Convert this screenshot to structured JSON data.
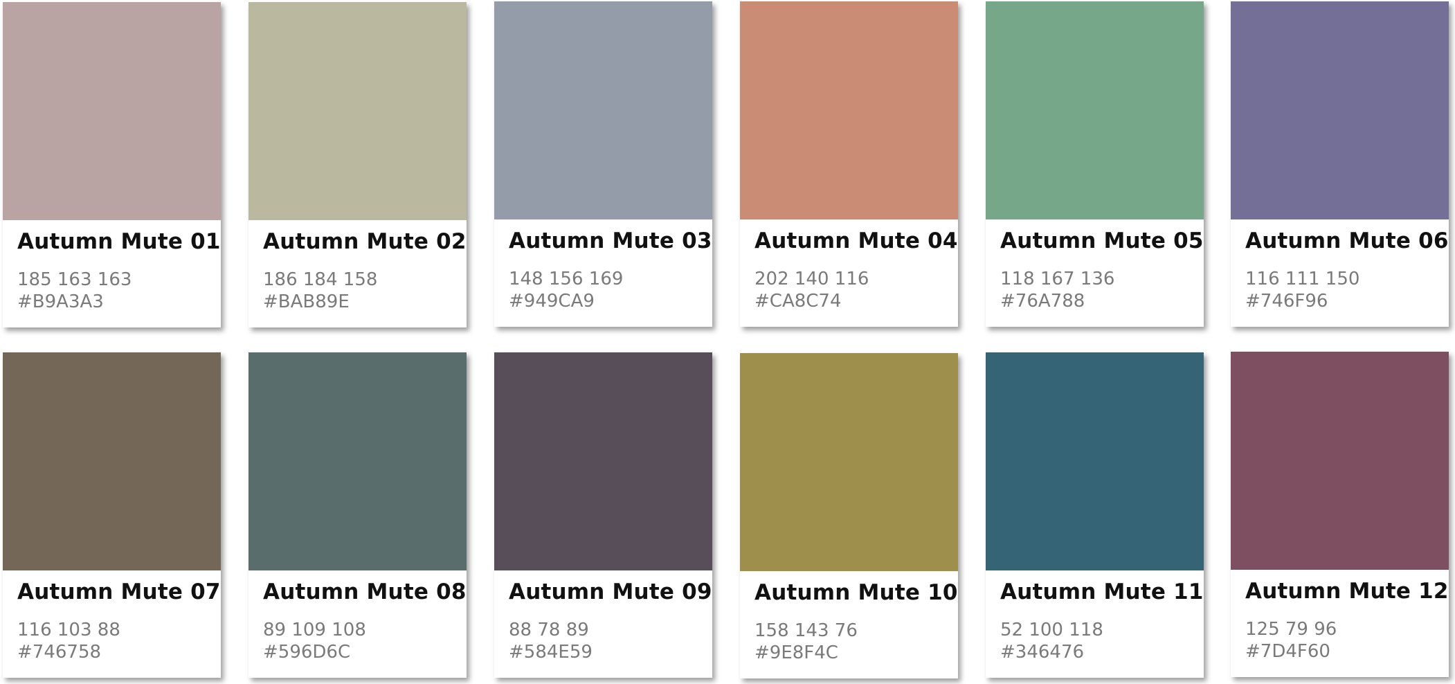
{
  "palette": {
    "swatches": [
      {
        "name": "Autumn Mute 01",
        "rgb": "185 163 163",
        "hex": "#B9A3A3",
        "color": "#B9A3A3"
      },
      {
        "name": "Autumn Mute 02",
        "rgb": "186 184 158",
        "hex": "#BAB89E",
        "color": "#BAB89E"
      },
      {
        "name": "Autumn Mute 03",
        "rgb": "148 156 169",
        "hex": "#949CA9",
        "color": "#949CA9"
      },
      {
        "name": "Autumn Mute 04",
        "rgb": "202 140 116",
        "hex": "#CA8C74",
        "color": "#CA8C74"
      },
      {
        "name": "Autumn Mute 05",
        "rgb": "118 167 136",
        "hex": "#76A788",
        "color": "#76A788"
      },
      {
        "name": "Autumn Mute 06",
        "rgb": "116 111 150",
        "hex": "#746F96",
        "color": "#746F96"
      },
      {
        "name": "Autumn Mute 07",
        "rgb": "116 103 88",
        "hex": "#746758",
        "color": "#746758"
      },
      {
        "name": "Autumn Mute 08",
        "rgb": "89 109 108",
        "hex": "#596D6C",
        "color": "#596D6C"
      },
      {
        "name": "Autumn Mute 09",
        "rgb": "88 78 89",
        "hex": "#584E59",
        "color": "#584E59"
      },
      {
        "name": "Autumn Mute 10",
        "rgb": "158 143 76",
        "hex": "#9E8F4C",
        "color": "#9E8F4C"
      },
      {
        "name": "Autumn Mute 11",
        "rgb": "52 100 118",
        "hex": "#346476",
        "color": "#346476"
      },
      {
        "name": "Autumn Mute 12",
        "rgb": "125 79 96",
        "hex": "#7D4F60",
        "color": "#7D4F60"
      }
    ]
  }
}
